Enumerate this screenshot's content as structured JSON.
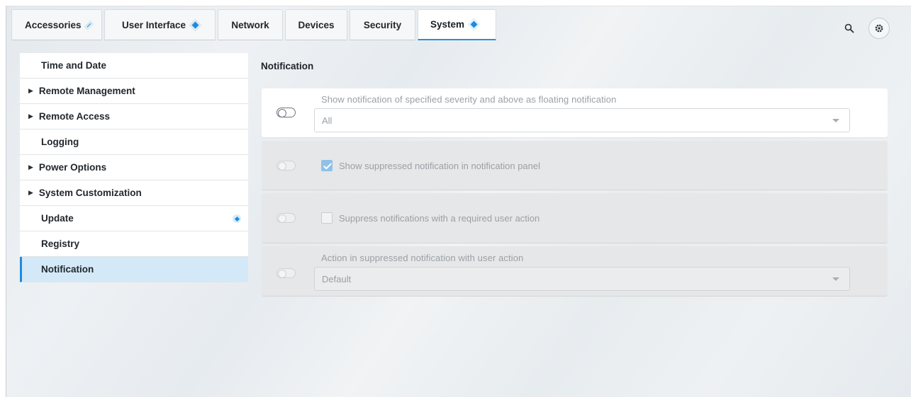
{
  "tabs": [
    {
      "label": "Accessories",
      "badge": true
    },
    {
      "label": "User Interface",
      "badge": true
    },
    {
      "label": "Network",
      "badge": false
    },
    {
      "label": "Devices",
      "badge": false
    },
    {
      "label": "Security",
      "badge": false
    },
    {
      "label": "System",
      "badge": true,
      "active": true
    }
  ],
  "toolbar": {
    "search_icon": "search-icon",
    "settings_icon": "gear-icon"
  },
  "sidebar": {
    "items": [
      {
        "label": "Time and Date",
        "expandable": false
      },
      {
        "label": "Remote Management",
        "expandable": true
      },
      {
        "label": "Remote Access",
        "expandable": true
      },
      {
        "label": "Logging",
        "expandable": false
      },
      {
        "label": "Power Options",
        "expandable": true
      },
      {
        "label": "System Customization",
        "expandable": true
      },
      {
        "label": "Update",
        "expandable": false,
        "badge": true
      },
      {
        "label": "Registry",
        "expandable": false
      },
      {
        "label": "Notification",
        "expandable": false,
        "active": true
      }
    ]
  },
  "main": {
    "title": "Notification",
    "settings": [
      {
        "label": "Show notification of specified severity and above as floating notification",
        "value": "All",
        "enabled": false,
        "available": true
      },
      {
        "label": "Show suppressed notification in notification panel",
        "checked": true,
        "available": false
      },
      {
        "label": "Suppress notifications with a required user action",
        "checked": false,
        "available": false
      },
      {
        "label": "Action in suppressed notification with user action",
        "value": "Default",
        "available": false
      }
    ]
  },
  "colors": {
    "accent": "#1d8be0",
    "active_row": "#d3e9f8"
  }
}
